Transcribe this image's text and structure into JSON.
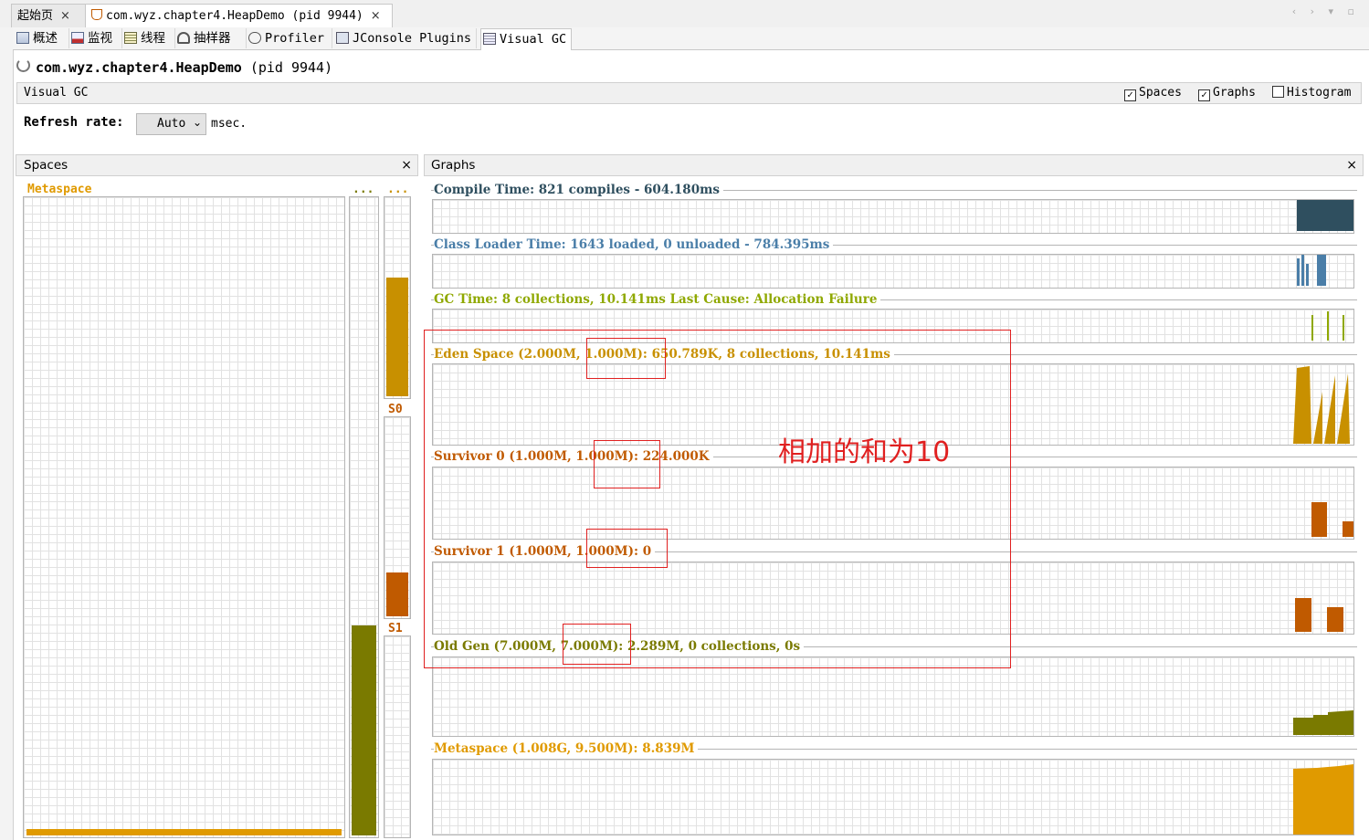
{
  "doc_tabs": [
    {
      "label": "起始页"
    },
    {
      "label": "com.wyz.chapter4.HeapDemo (pid 9944)"
    }
  ],
  "sub_tabs": [
    {
      "label": "概述",
      "icon": "overview-icon"
    },
    {
      "label": "监视",
      "icon": "monitor-icon"
    },
    {
      "label": "线程",
      "icon": "threads-icon"
    },
    {
      "label": "抽样器",
      "icon": "sampler-icon"
    },
    {
      "label": "Profiler",
      "icon": "profiler-icon"
    },
    {
      "label": "JConsole Plugins",
      "icon": "jconsole-icon"
    },
    {
      "label": "Visual GC",
      "icon": "visual-gc-icon"
    }
  ],
  "page_title": {
    "name": "com.wyz.chapter4.HeapDemo",
    "pid": "(pid 9944)"
  },
  "visual_gc_bar": {
    "label": "Visual GC",
    "options": [
      {
        "label": "Spaces",
        "checked": true
      },
      {
        "label": "Graphs",
        "checked": true
      },
      {
        "label": "Histogram",
        "checked": false
      }
    ]
  },
  "refresh": {
    "label": "Refresh rate:",
    "value": "Auto",
    "unit": "msec."
  },
  "spaces_panel": {
    "title": "Spaces",
    "close": "×",
    "metaspace_label": "Metaspace",
    "old_label": "...",
    "eden_label": "...",
    "s0_label": "S0",
    "s1_label": "S1",
    "levels": {
      "metaspace": 0.01,
      "old": 0.33,
      "eden": 0.6,
      "s0": 0.22,
      "s1": 0.0
    }
  },
  "graphs_panel": {
    "title": "Graphs",
    "close": "×",
    "graphs": [
      {
        "title": "Compile Time: 821 compiles - 604.180ms",
        "color": "#2f4f5f"
      },
      {
        "title": "Class Loader Time: 1643 loaded, 0 unloaded - 784.395ms",
        "color": "#4a7ea8"
      },
      {
        "title": "GC Time: 8 collections, 10.141ms Last Cause: Allocation Failure",
        "color": "#8fa800"
      },
      {
        "title": "Eden Space (2.000M, 1.000M): 650.789K, 8 collections, 10.141ms",
        "color": "#c89000"
      },
      {
        "title": "Survivor 0 (1.000M, 1.000M): 224.000K",
        "color": "#c05a00"
      },
      {
        "title": "Survivor 1 (1.000M, 1.000M): 0",
        "color": "#c05a00"
      },
      {
        "title": "Old Gen (7.000M, 7.000M): 2.289M, 0 collections, 0s",
        "color": "#7a7a00"
      },
      {
        "title": "Metaspace (1.008G, 9.500M): 8.839M",
        "color": "#e09a00"
      }
    ]
  },
  "annotation": "相加的和为10",
  "colors": {
    "metaspace": "#e09a00",
    "old": "#7a7a00",
    "eden": "#c89000",
    "survivor": "#c05a00",
    "annotation": "#e02020"
  }
}
